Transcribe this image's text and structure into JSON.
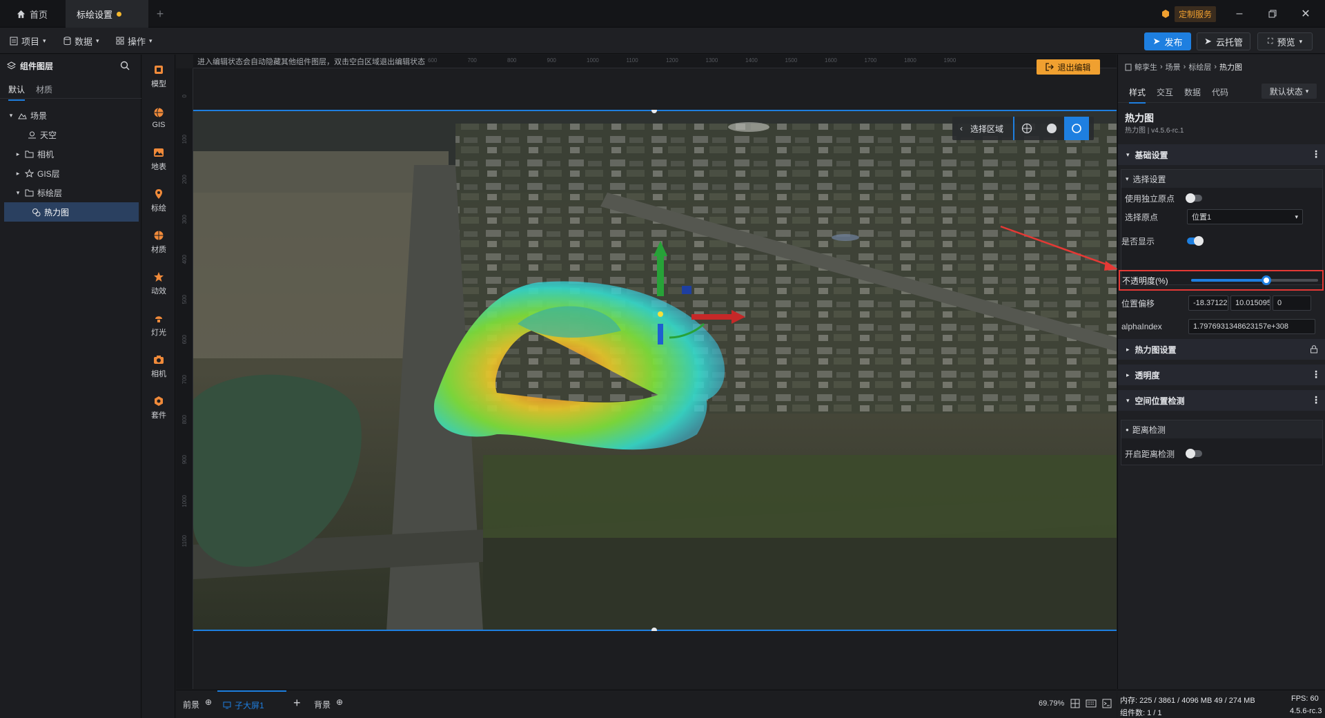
{
  "titlebar": {
    "tabs": [
      {
        "label": "首页"
      },
      {
        "label": "标绘设置"
      }
    ],
    "service_label": "定制服务"
  },
  "menubar": {
    "items": [
      {
        "label": "项目"
      },
      {
        "label": "数据"
      },
      {
        "label": "操作"
      }
    ],
    "publish_label": "发布",
    "cloud_label": "云托管",
    "preview_label": "预览"
  },
  "leftpanel": {
    "title": "组件图层",
    "tabs": [
      {
        "label": "默认"
      },
      {
        "label": "材质"
      }
    ],
    "tree": [
      {
        "label": "场景"
      },
      {
        "label": "天空"
      },
      {
        "label": "相机"
      },
      {
        "label": "GIS层"
      },
      {
        "label": "标绘层"
      },
      {
        "label": "热力图"
      }
    ]
  },
  "tools": [
    {
      "label": "模型"
    },
    {
      "label": "GIS"
    },
    {
      "label": "地表"
    },
    {
      "label": "标绘"
    },
    {
      "label": "材质"
    },
    {
      "label": "动效"
    },
    {
      "label": "灯光"
    },
    {
      "label": "相机"
    },
    {
      "label": "套件"
    }
  ],
  "canvas": {
    "hint": "进入编辑状态会自动隐藏其他组件图层，双击空白区域退出编辑状态",
    "exit_label": "退出编辑",
    "ruler_top": [
      "600",
      "700",
      "800",
      "900",
      "1000",
      "1100",
      "1200",
      "1300",
      "1400",
      "1500",
      "1600",
      "1700",
      "1800",
      "1900"
    ],
    "ruler_left": [
      "0",
      "100",
      "200",
      "300",
      "400",
      "500",
      "600",
      "700",
      "800",
      "900",
      "1000",
      "1100"
    ],
    "select_area_label": "选择区域"
  },
  "rightpanel": {
    "breadcrumb": [
      "鲸孪生",
      "场景",
      "标绘层",
      "热力图"
    ],
    "tabs": [
      {
        "label": "样式"
      },
      {
        "label": "交互"
      },
      {
        "label": "数据"
      },
      {
        "label": "代码"
      }
    ],
    "state_label": "默认状态",
    "comp_title": "热力图",
    "comp_version": "热力图 | v4.5.6-rc.1",
    "sections": {
      "basic": "基础设置",
      "select": "选择设置",
      "heatmap": "热力图设置",
      "transparency": "透明度",
      "space": "空间位置检测",
      "distance": "距离检测"
    },
    "props": {
      "use_origin_label": "使用独立原点",
      "use_origin": false,
      "origin_label": "选择原点",
      "origin_value": "位置1",
      "visible_label": "是否显示",
      "visible": true,
      "opacity_label": "不透明度(%)",
      "opacity": 0.59,
      "offset_label": "位置偏移",
      "offset": [
        "-18.371223",
        "10.015095",
        "0"
      ],
      "alpha_label": "alphaIndex",
      "alpha_value": "1.7976931348623157e+308",
      "distance_label": "开启距离检测",
      "distance": false
    }
  },
  "bottombar": {
    "front_label": "前景",
    "screen_label": "子大屏1",
    "bg_label": "背景",
    "zoom": "69.79%"
  },
  "status": {
    "memory": "内存: 225 / 3861 / 4096 MB  49 / 274 MB",
    "fps": "FPS: 60",
    "components": "组件数: 1 / 1",
    "version": "4.5.6-rc.3"
  },
  "colors": {
    "accent": "#1e7fe0",
    "exit_button": "#f0a030",
    "highlight_box": "#e53935",
    "arrow": "#e53935"
  }
}
